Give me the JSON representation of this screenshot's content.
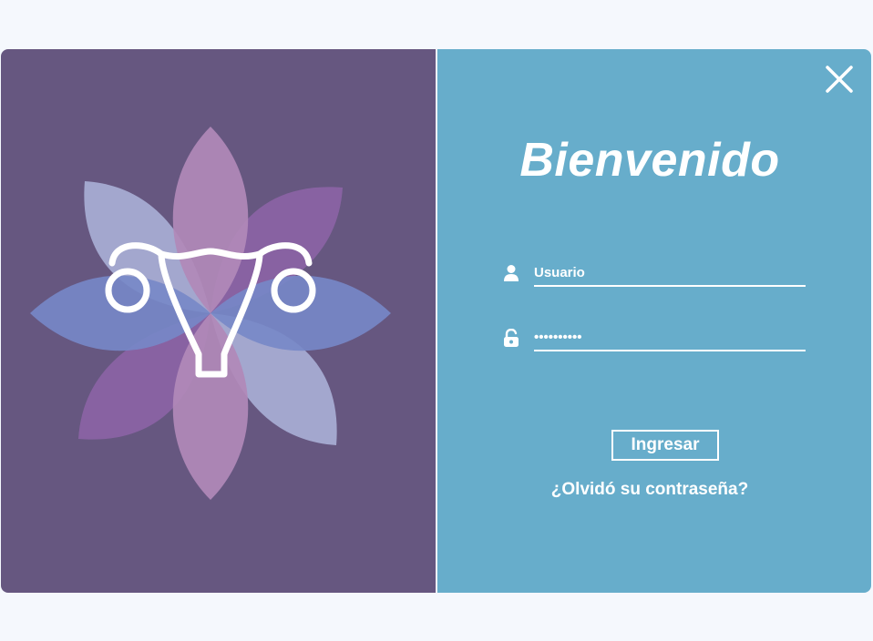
{
  "window": {
    "left_color": "#665780",
    "right_color": "#67adcb",
    "logo_icon": "uterus-flower-logo-icon",
    "close_icon": "close-icon"
  },
  "login": {
    "title": "Bienvenido",
    "username_placeholder": "Usuario",
    "username_value": "",
    "username_icon": "user-icon",
    "password_value": "••••••••••",
    "password_icon": "unlock-icon",
    "submit_label": "Ingresar",
    "forgot_label": "¿Olvidó su contraseña?"
  }
}
